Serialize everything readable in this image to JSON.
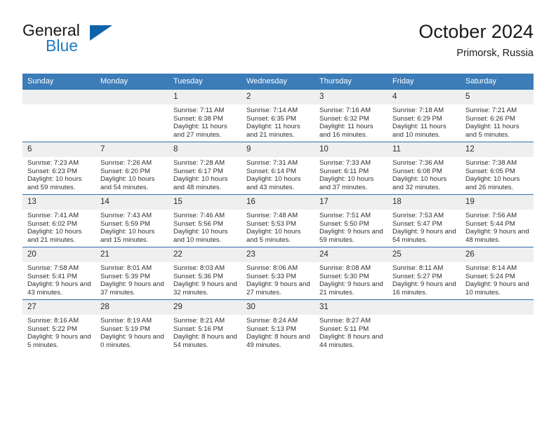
{
  "brand": {
    "name_top": "General",
    "name_bottom": "Blue",
    "accent_color": "#1e7bc4",
    "triangle_color": "#1063a8"
  },
  "header": {
    "title": "October 2024",
    "subtitle": "Primorsk, Russia"
  },
  "theme": {
    "header_row_bg": "#3c7cb8",
    "daynum_bg": "#efefef",
    "row_divider": "#2f6daa",
    "text": "#303030"
  },
  "weekdays": [
    "Sunday",
    "Monday",
    "Tuesday",
    "Wednesday",
    "Thursday",
    "Friday",
    "Saturday"
  ],
  "labels": {
    "sunrise": "Sunrise:",
    "sunset": "Sunset:",
    "daylight": "Daylight:"
  },
  "weeks": [
    [
      {
        "day": "",
        "blank": true
      },
      {
        "day": "",
        "blank": true
      },
      {
        "day": "1",
        "sunrise": "Sunrise: 7:11 AM",
        "sunset": "Sunset: 6:38 PM",
        "daylight": "Daylight: 11 hours and 27 minutes."
      },
      {
        "day": "2",
        "sunrise": "Sunrise: 7:14 AM",
        "sunset": "Sunset: 6:35 PM",
        "daylight": "Daylight: 11 hours and 21 minutes."
      },
      {
        "day": "3",
        "sunrise": "Sunrise: 7:16 AM",
        "sunset": "Sunset: 6:32 PM",
        "daylight": "Daylight: 11 hours and 16 minutes."
      },
      {
        "day": "4",
        "sunrise": "Sunrise: 7:18 AM",
        "sunset": "Sunset: 6:29 PM",
        "daylight": "Daylight: 11 hours and 10 minutes."
      },
      {
        "day": "5",
        "sunrise": "Sunrise: 7:21 AM",
        "sunset": "Sunset: 6:26 PM",
        "daylight": "Daylight: 11 hours and 5 minutes."
      }
    ],
    [
      {
        "day": "6",
        "sunrise": "Sunrise: 7:23 AM",
        "sunset": "Sunset: 6:23 PM",
        "daylight": "Daylight: 10 hours and 59 minutes."
      },
      {
        "day": "7",
        "sunrise": "Sunrise: 7:26 AM",
        "sunset": "Sunset: 6:20 PM",
        "daylight": "Daylight: 10 hours and 54 minutes."
      },
      {
        "day": "8",
        "sunrise": "Sunrise: 7:28 AM",
        "sunset": "Sunset: 6:17 PM",
        "daylight": "Daylight: 10 hours and 48 minutes."
      },
      {
        "day": "9",
        "sunrise": "Sunrise: 7:31 AM",
        "sunset": "Sunset: 6:14 PM",
        "daylight": "Daylight: 10 hours and 43 minutes."
      },
      {
        "day": "10",
        "sunrise": "Sunrise: 7:33 AM",
        "sunset": "Sunset: 6:11 PM",
        "daylight": "Daylight: 10 hours and 37 minutes."
      },
      {
        "day": "11",
        "sunrise": "Sunrise: 7:36 AM",
        "sunset": "Sunset: 6:08 PM",
        "daylight": "Daylight: 10 hours and 32 minutes."
      },
      {
        "day": "12",
        "sunrise": "Sunrise: 7:38 AM",
        "sunset": "Sunset: 6:05 PM",
        "daylight": "Daylight: 10 hours and 26 minutes."
      }
    ],
    [
      {
        "day": "13",
        "sunrise": "Sunrise: 7:41 AM",
        "sunset": "Sunset: 6:02 PM",
        "daylight": "Daylight: 10 hours and 21 minutes."
      },
      {
        "day": "14",
        "sunrise": "Sunrise: 7:43 AM",
        "sunset": "Sunset: 5:59 PM",
        "daylight": "Daylight: 10 hours and 15 minutes."
      },
      {
        "day": "15",
        "sunrise": "Sunrise: 7:46 AM",
        "sunset": "Sunset: 5:56 PM",
        "daylight": "Daylight: 10 hours and 10 minutes."
      },
      {
        "day": "16",
        "sunrise": "Sunrise: 7:48 AM",
        "sunset": "Sunset: 5:53 PM",
        "daylight": "Daylight: 10 hours and 5 minutes."
      },
      {
        "day": "17",
        "sunrise": "Sunrise: 7:51 AM",
        "sunset": "Sunset: 5:50 PM",
        "daylight": "Daylight: 9 hours and 59 minutes."
      },
      {
        "day": "18",
        "sunrise": "Sunrise: 7:53 AM",
        "sunset": "Sunset: 5:47 PM",
        "daylight": "Daylight: 9 hours and 54 minutes."
      },
      {
        "day": "19",
        "sunrise": "Sunrise: 7:56 AM",
        "sunset": "Sunset: 5:44 PM",
        "daylight": "Daylight: 9 hours and 48 minutes."
      }
    ],
    [
      {
        "day": "20",
        "sunrise": "Sunrise: 7:58 AM",
        "sunset": "Sunset: 5:41 PM",
        "daylight": "Daylight: 9 hours and 43 minutes."
      },
      {
        "day": "21",
        "sunrise": "Sunrise: 8:01 AM",
        "sunset": "Sunset: 5:39 PM",
        "daylight": "Daylight: 9 hours and 37 minutes."
      },
      {
        "day": "22",
        "sunrise": "Sunrise: 8:03 AM",
        "sunset": "Sunset: 5:36 PM",
        "daylight": "Daylight: 9 hours and 32 minutes."
      },
      {
        "day": "23",
        "sunrise": "Sunrise: 8:06 AM",
        "sunset": "Sunset: 5:33 PM",
        "daylight": "Daylight: 9 hours and 27 minutes."
      },
      {
        "day": "24",
        "sunrise": "Sunrise: 8:08 AM",
        "sunset": "Sunset: 5:30 PM",
        "daylight": "Daylight: 9 hours and 21 minutes."
      },
      {
        "day": "25",
        "sunrise": "Sunrise: 8:11 AM",
        "sunset": "Sunset: 5:27 PM",
        "daylight": "Daylight: 9 hours and 16 minutes."
      },
      {
        "day": "26",
        "sunrise": "Sunrise: 8:14 AM",
        "sunset": "Sunset: 5:24 PM",
        "daylight": "Daylight: 9 hours and 10 minutes."
      }
    ],
    [
      {
        "day": "27",
        "sunrise": "Sunrise: 8:16 AM",
        "sunset": "Sunset: 5:22 PM",
        "daylight": "Daylight: 9 hours and 5 minutes."
      },
      {
        "day": "28",
        "sunrise": "Sunrise: 8:19 AM",
        "sunset": "Sunset: 5:19 PM",
        "daylight": "Daylight: 9 hours and 0 minutes."
      },
      {
        "day": "29",
        "sunrise": "Sunrise: 8:21 AM",
        "sunset": "Sunset: 5:16 PM",
        "daylight": "Daylight: 8 hours and 54 minutes."
      },
      {
        "day": "30",
        "sunrise": "Sunrise: 8:24 AM",
        "sunset": "Sunset: 5:13 PM",
        "daylight": "Daylight: 8 hours and 49 minutes."
      },
      {
        "day": "31",
        "sunrise": "Sunrise: 8:27 AM",
        "sunset": "Sunset: 5:11 PM",
        "daylight": "Daylight: 8 hours and 44 minutes."
      },
      {
        "day": "",
        "blank": true
      },
      {
        "day": "",
        "blank": true
      }
    ]
  ]
}
